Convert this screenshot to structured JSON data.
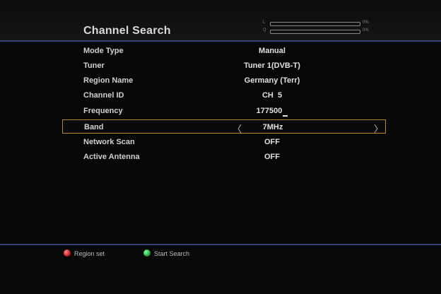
{
  "header": {
    "title": "Channel Search",
    "signal": {
      "level_label": "L",
      "level_percent_label": "0%",
      "level_fraction": 0,
      "quality_label": "Q",
      "quality_percent_label": "0%",
      "quality_fraction": 0
    }
  },
  "settings": [
    {
      "label": "Mode Type",
      "value": "Manual"
    },
    {
      "label": "Tuner",
      "value": "Tuner 1(DVB-T)"
    },
    {
      "label": "Region Name",
      "value": "Germany (Terr)"
    },
    {
      "label": "Channel ID",
      "value": "CH  5"
    },
    {
      "label": "Frequency",
      "value": "177500"
    },
    {
      "label": "Band",
      "value": "7MHz",
      "selected": true
    },
    {
      "label": "Network Scan",
      "value": "OFF"
    },
    {
      "label": "Active Antenna",
      "value": "OFF"
    }
  ],
  "arrows": {
    "left": "〈",
    "right": "〉"
  },
  "footer": {
    "red_hint": "Region set",
    "green_hint": "Start Search"
  },
  "colors": {
    "accent_rule": "#3a3f7a",
    "selection_border": "#b8862b",
    "red_key": "#c32020",
    "green_key": "#23a53b"
  }
}
